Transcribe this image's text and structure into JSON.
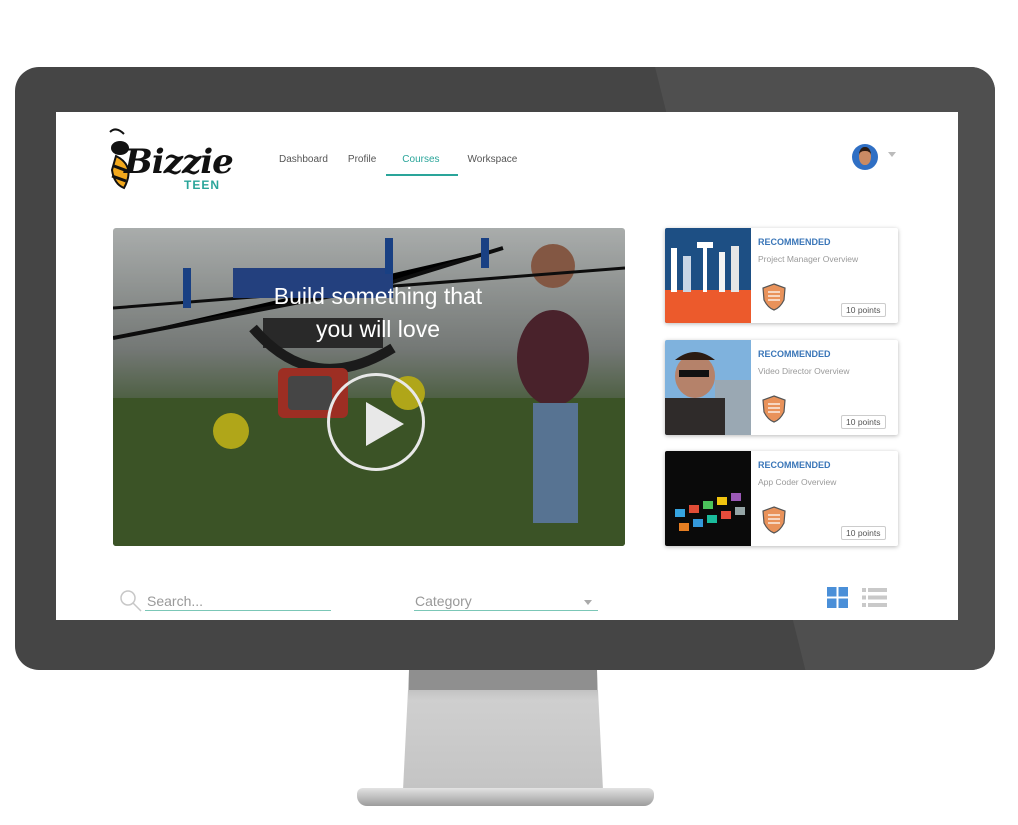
{
  "nav": {
    "logo_text": "Bizzie",
    "logo_sub": "TEEN",
    "items": [
      {
        "label": "Dashboard"
      },
      {
        "label": "Profile"
      },
      {
        "label": "Courses"
      },
      {
        "label": "Workspace"
      }
    ],
    "active": "Courses"
  },
  "hero": {
    "title_line1": "Build something that",
    "title_line2": "you will love"
  },
  "recommendations": [
    {
      "tag": "RECOMMENDED",
      "title": "Project Manager Overview",
      "points": "10 points"
    },
    {
      "tag": "RECOMMENDED",
      "title": "Video Director Overview",
      "points": "10 points"
    },
    {
      "tag": "RECOMMENDED",
      "title": "App Coder Overview",
      "points": "10 points"
    }
  ],
  "filters": {
    "search_placeholder": "Search...",
    "category_placeholder": "Category"
  },
  "colors": {
    "accent": "#2aa59a",
    "tag_blue": "#3a76b8",
    "grid_active": "#4a8fd8"
  }
}
